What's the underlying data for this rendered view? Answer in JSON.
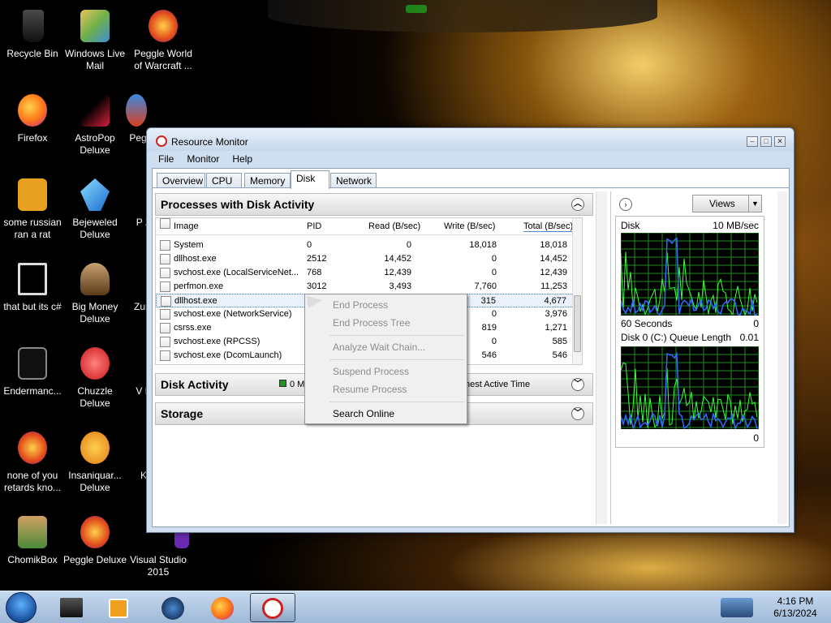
{
  "desktop": {
    "icons": [
      {
        "label": "Recycle Bin"
      },
      {
        "label": "Windows Live Mail"
      },
      {
        "label": "Peggle World of Warcraft ..."
      },
      {
        "label": "Firefox"
      },
      {
        "label": "AstroPop Deluxe"
      },
      {
        "label": "Peg"
      },
      {
        "label": "some russian ran a rat"
      },
      {
        "label": "Bejeweled Deluxe"
      },
      {
        "label": "P Z"
      },
      {
        "label": "that but its c#"
      },
      {
        "label": "Big Money Deluxe"
      },
      {
        "label": "Zur"
      },
      {
        "label": "Endermanc..."
      },
      {
        "label": "Chuzzle Deluxe"
      },
      {
        "label": "V K"
      },
      {
        "label": "none of you retards kno..."
      },
      {
        "label": "Insaniquar... Deluxe"
      },
      {
        "label": "K"
      },
      {
        "label": "ChomikBox"
      },
      {
        "label": "Peggle Deluxe"
      },
      {
        "label": "Visual Studio 2015"
      }
    ]
  },
  "window": {
    "title": "Resource Monitor",
    "menu": [
      "File",
      "Monitor",
      "Help"
    ],
    "tabs": [
      "Overview",
      "CPU",
      "Memory",
      "Disk",
      "Network"
    ],
    "active_tab": "Disk"
  },
  "processes": {
    "title": "Processes with Disk Activity",
    "columns": [
      "Image",
      "PID",
      "Read (B/sec)",
      "Write (B/sec)",
      "Total (B/sec)"
    ],
    "rows": [
      {
        "image": "System",
        "pid": "0",
        "read": "0",
        "write": "18,018",
        "total": "18,018"
      },
      {
        "image": "dllhost.exe",
        "pid": "2512",
        "read": "14,452",
        "write": "0",
        "total": "14,452"
      },
      {
        "image": "svchost.exe (LocalServiceNet...",
        "pid": "768",
        "read": "12,439",
        "write": "0",
        "total": "12,439"
      },
      {
        "image": "perfmon.exe",
        "pid": "3012",
        "read": "3,493",
        "write": "7,760",
        "total": "11,253"
      },
      {
        "image": "dllhost.exe",
        "pid": "",
        "read": "",
        "write": "315",
        "total": "4,677"
      },
      {
        "image": "svchost.exe (NetworkService)",
        "pid": "",
        "read": "",
        "write": "0",
        "total": "3,976"
      },
      {
        "image": "csrss.exe",
        "pid": "",
        "read": "",
        "write": "819",
        "total": "1,271"
      },
      {
        "image": "svchost.exe (RPCSS)",
        "pid": "",
        "read": "",
        "write": "0",
        "total": "585"
      },
      {
        "image": "svchost.exe (DcomLaunch)",
        "pid": "",
        "read": "",
        "write": "546",
        "total": "546"
      }
    ]
  },
  "disk_activity": {
    "title": "Disk Activity",
    "stat": "0 M",
    "active_time": "hest Active Time"
  },
  "storage": {
    "title": "Storage"
  },
  "context_menu": {
    "items": [
      {
        "label": "End Process",
        "enabled": false
      },
      {
        "label": "End Process Tree",
        "enabled": false
      },
      {
        "label": "Analyze Wait Chain...",
        "enabled": false
      },
      {
        "label": "Suspend Process",
        "enabled": false
      },
      {
        "label": "Resume Process",
        "enabled": false
      },
      {
        "label": "Search Online",
        "enabled": true
      }
    ]
  },
  "right_pane": {
    "views_label": "Views",
    "graph1": {
      "title": "Disk",
      "max": "10 MB/sec",
      "left_bottom": "60 Seconds",
      "right_bottom": "0"
    },
    "graph2": {
      "title": "Disk 0 (C:) Queue Length",
      "max": "0.01",
      "right_bottom": "0"
    },
    "colors": {
      "graph_bg": "#000000",
      "grid": "#1f8a1f",
      "line_green": "#3cff3c",
      "line_blue": "#2f6cff"
    }
  },
  "taskbar": {
    "time": "4:16 PM",
    "date": "6/13/2024",
    "buttons": [
      "explorer",
      "media player",
      "settings",
      "firefox",
      "resource monitor"
    ]
  }
}
